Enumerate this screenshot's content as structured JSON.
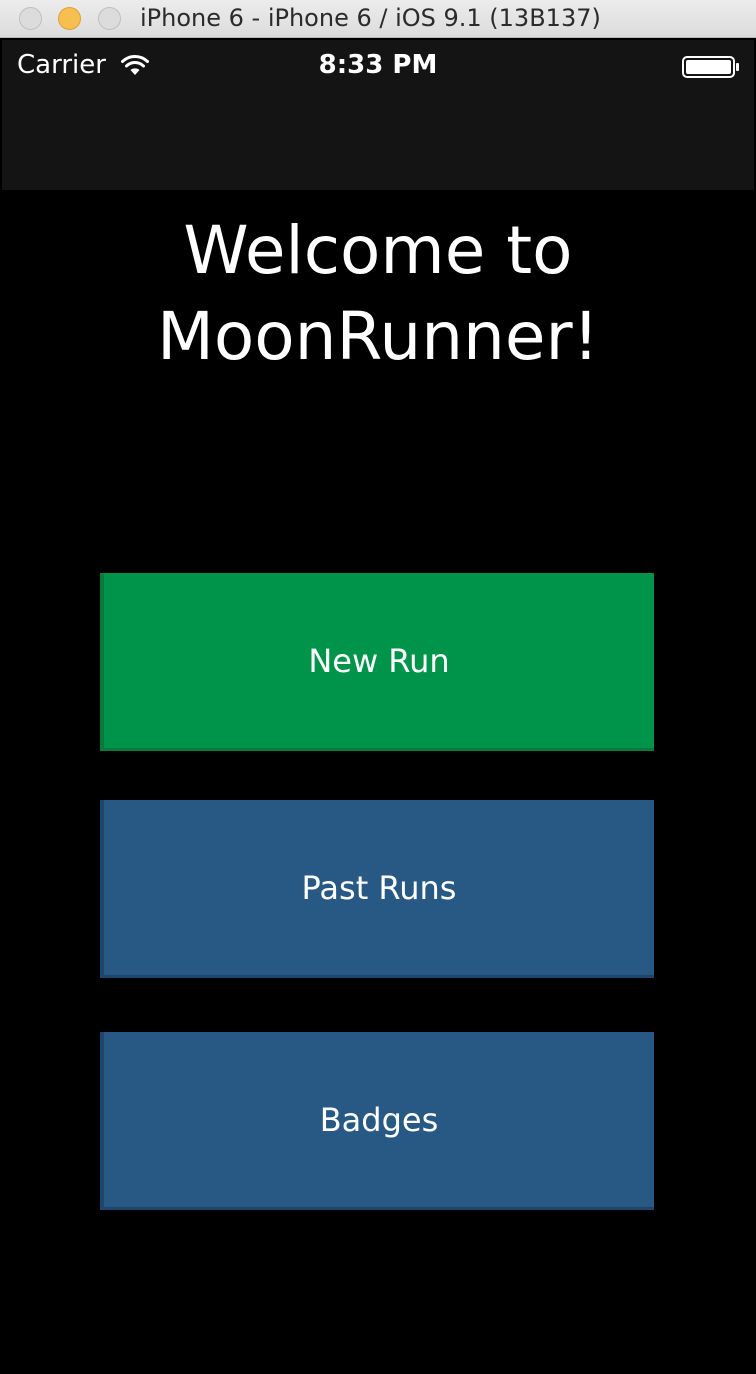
{
  "window": {
    "title": "iPhone 6 - iPhone 6 / iOS 9.1 (13B137)"
  },
  "status_bar": {
    "carrier": "Carrier",
    "time": "8:33 PM",
    "wifi_icon": "wifi-icon",
    "battery_icon": "battery-icon"
  },
  "main": {
    "welcome_line1": "Welcome to",
    "welcome_line2": "MoonRunner!",
    "buttons": [
      {
        "label": "New Run",
        "color": "#00944a"
      },
      {
        "label": "Past Runs",
        "color": "#275984"
      },
      {
        "label": "Badges",
        "color": "#275984"
      }
    ]
  }
}
